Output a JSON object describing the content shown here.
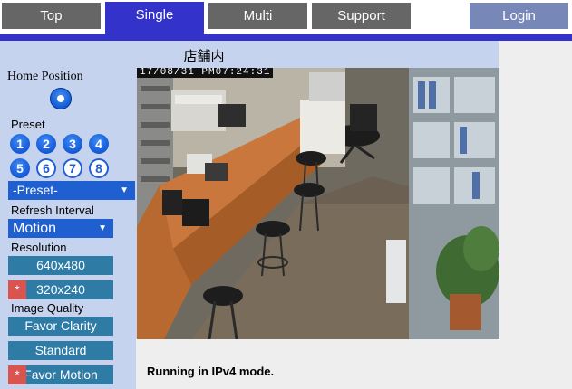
{
  "nav": {
    "tabs": [
      {
        "label": "Top"
      },
      {
        "label": "Single"
      },
      {
        "label": "Multi"
      },
      {
        "label": "Support"
      }
    ],
    "login_label": "Login",
    "active_tab": "Single",
    "accent_color": "#3333cc"
  },
  "panel": {
    "home_position_label": "Home Position",
    "preset_label": "Preset",
    "preset_buttons": [
      "1",
      "2",
      "3",
      "4",
      "5",
      "6",
      "7",
      "8"
    ],
    "preset_select": "-Preset-",
    "refresh_interval_label": "Refresh Interval",
    "refresh_select": "Motion",
    "resolution_label": "Resolution",
    "resolution_options": [
      {
        "label": "640x480",
        "selected": false
      },
      {
        "label": "320x240",
        "selected": true
      }
    ],
    "image_quality_label": "Image Quality",
    "quality_options": [
      {
        "label": "Favor Clarity",
        "selected": false
      },
      {
        "label": "Standard",
        "selected": false
      },
      {
        "label": "Favor Motion",
        "selected": true
      }
    ],
    "selected_marker": "*"
  },
  "camera": {
    "title": "店舗内",
    "timestamp": "17/08/31 PM07:24:31"
  },
  "status_text": "Running in IPv4 mode."
}
